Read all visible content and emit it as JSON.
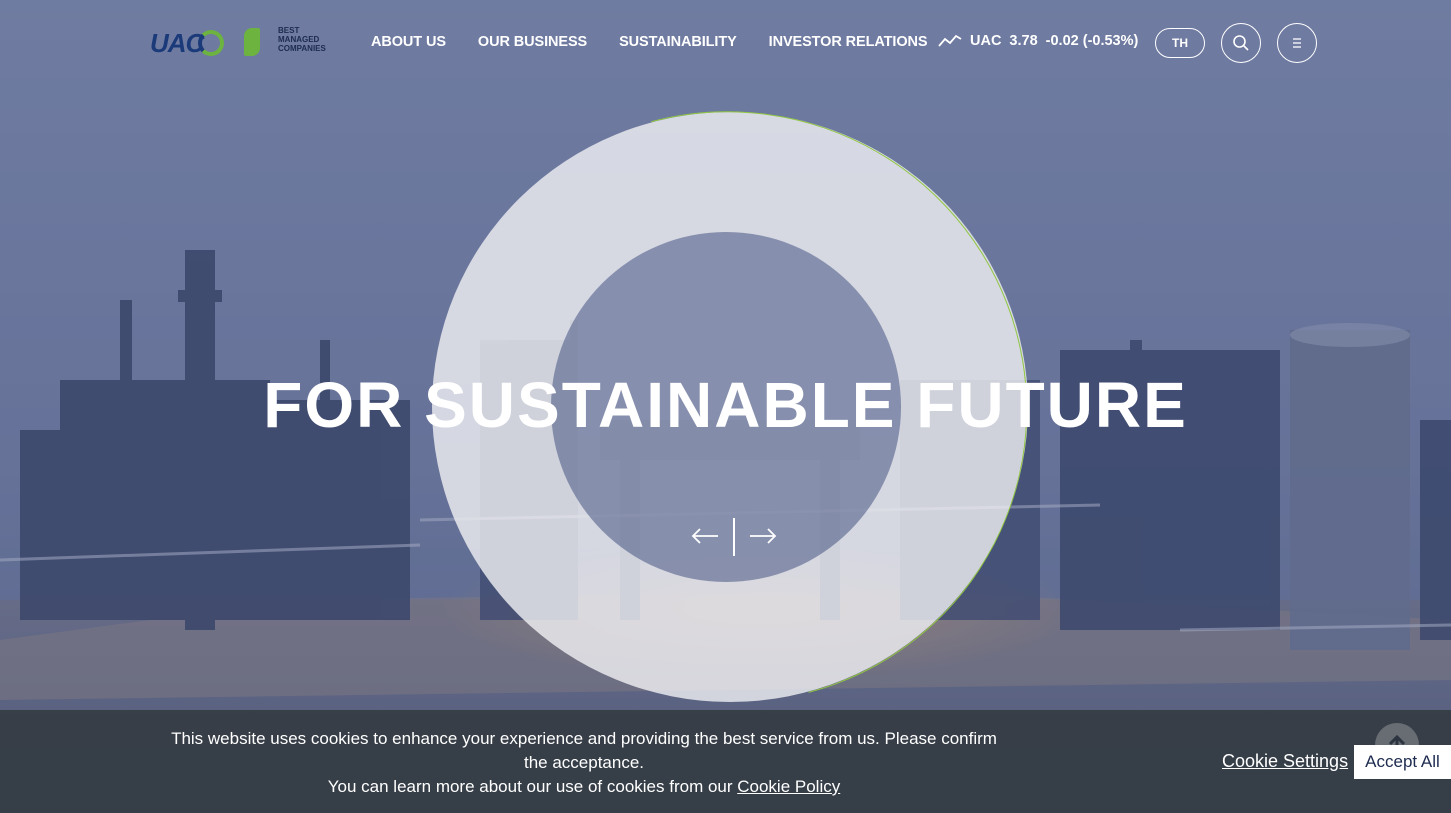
{
  "header": {
    "logo_text": "UAC",
    "award_text": [
      "BEST",
      "MANAGED",
      "COMPANIES"
    ],
    "nav": [
      {
        "label": "ABOUT US"
      },
      {
        "label": "OUR BUSINESS"
      },
      {
        "label": "SUSTAINABILITY"
      },
      {
        "label": "INVESTOR RELATIONS"
      }
    ],
    "stock": {
      "icon": "stock-trend-icon",
      "symbol": "UAC",
      "price": "3.78",
      "change": "-0.02 (-0.53%)"
    },
    "lang_label": "TH",
    "search_icon": "search-icon",
    "menu_icon": "menu-icon"
  },
  "hero": {
    "headline": "FOR SUSTAINABLE FUTURE",
    "prev_icon": "arrow-left-icon",
    "next_icon": "arrow-right-icon"
  },
  "cookie": {
    "line1": "This website uses cookies to enhance your experience and providing the best service from us. Please confirm the acceptance.",
    "line2": "You can learn more about our use of cookies from our ",
    "policy_link": "Cookie Policy",
    "settings_label": "Cookie Settings",
    "accept_label": "Accept All"
  },
  "colors": {
    "brand_navy": "#1b3a7a",
    "brand_green": "#6cb33f",
    "ring_accent": "#8fc640"
  }
}
